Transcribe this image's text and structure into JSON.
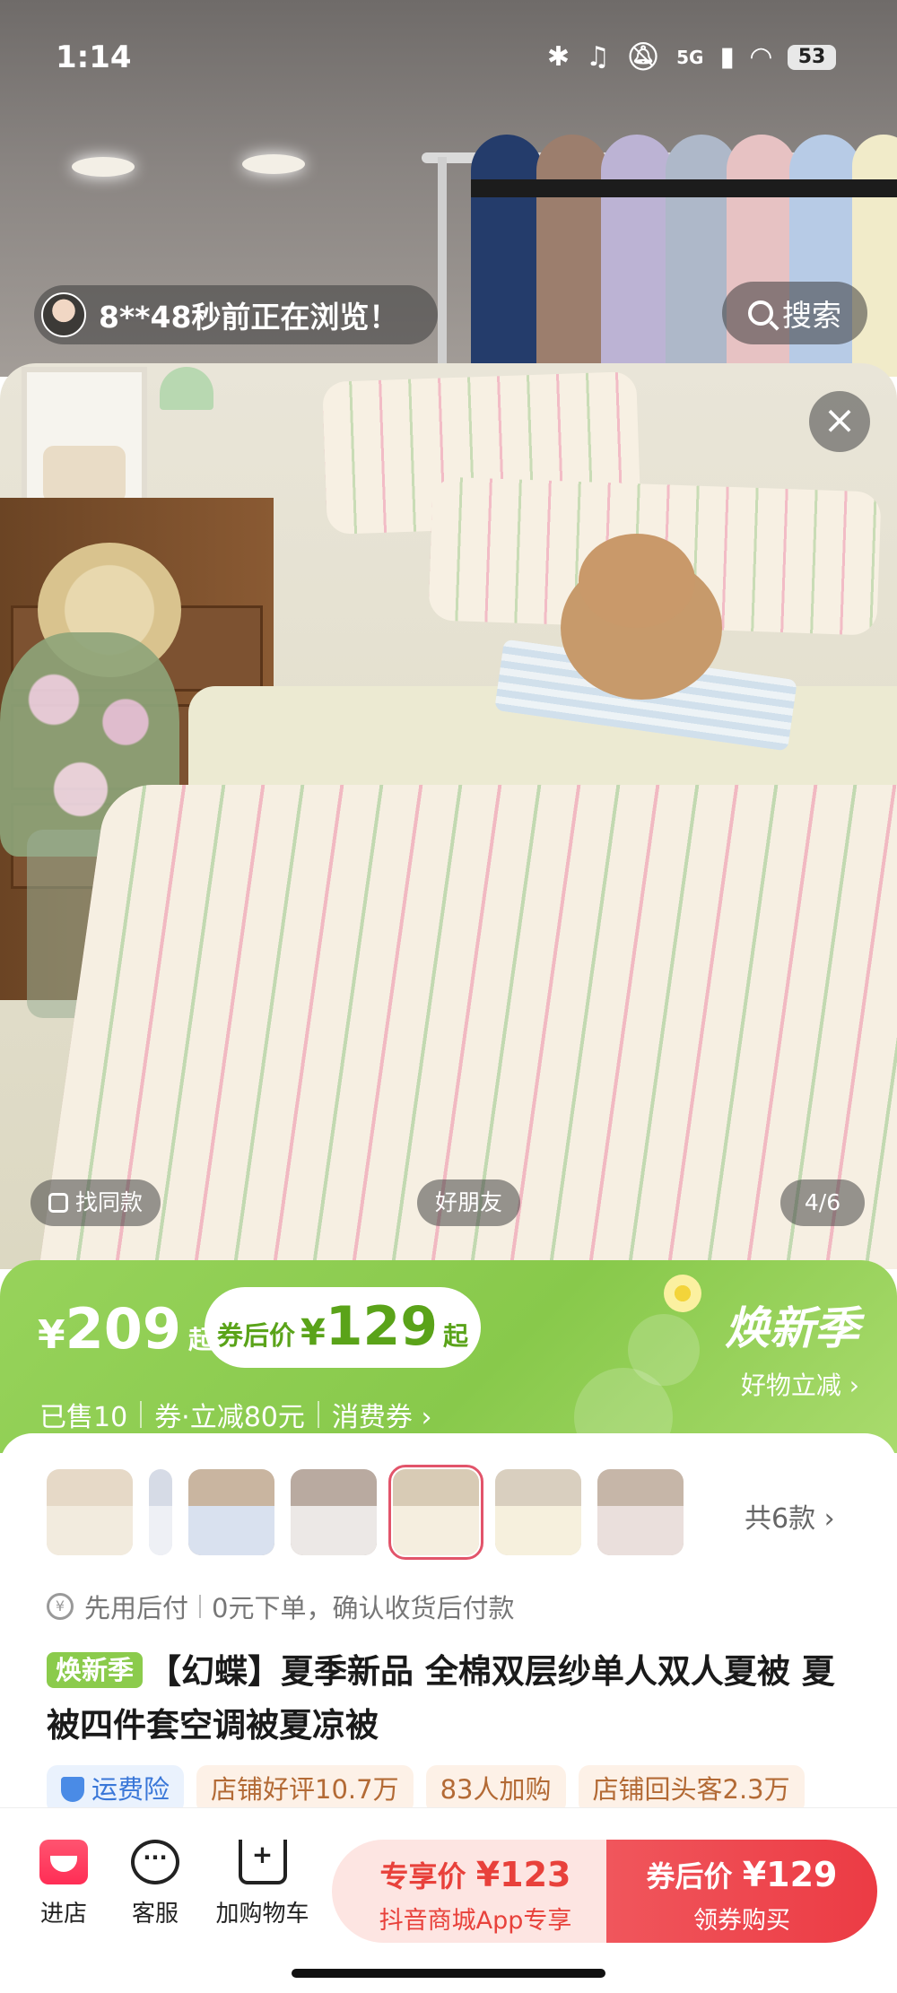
{
  "status_bar": {
    "time": "1:14",
    "network": "5G",
    "battery": "53"
  },
  "browse_notice": {
    "text": "8**48秒前正在浏览！"
  },
  "search": {
    "label": "搜索"
  },
  "gallery": {
    "find_similar": "找同款",
    "friend_tag": "好朋友",
    "page_indicator": "4/6"
  },
  "price": {
    "currency": "¥",
    "base_price": "209",
    "base_suffix": "起",
    "coupon_label": "券后价",
    "coupon_price": "129",
    "coupon_suffix": "起",
    "sold": "已售10",
    "coupon_info": "券·立减80元",
    "consumer_coupon": "消费券",
    "season_title": "焕新季",
    "season_sub": "好物立减"
  },
  "variants": {
    "count_label": "共6款",
    "selected_index": 4
  },
  "pay_later": {
    "text1": "先用后付",
    "text2": "0元下单，确认收货后付款"
  },
  "product": {
    "tag": "焕新季",
    "title": "【幻蝶】夏季新品 全棉双层纱单人双人夏被 夏被四件套空调被夏凉被"
  },
  "badges": [
    "运费险",
    "店铺好评10.7万",
    "83人加购",
    "店铺回头客2.3万"
  ],
  "bottom_bar": {
    "store": "进店",
    "service": "客服",
    "add_cart": "加购物车",
    "exclusive_label": "专享价",
    "exclusive_price": "¥123",
    "exclusive_sub": "抖音商城App专享",
    "buy_label": "券后价",
    "buy_price": "¥129",
    "buy_sub": "领券购买"
  },
  "colors": {
    "accent_green": "#8bcb4c",
    "buy_red": "#ec3b44",
    "exclusive_bg": "#fde5e2"
  }
}
